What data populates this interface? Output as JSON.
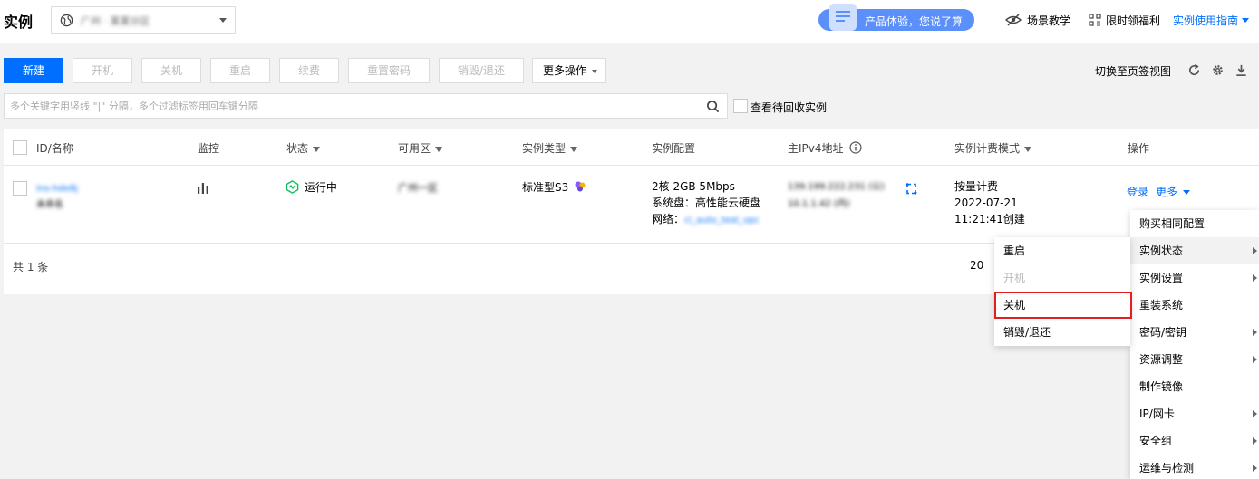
{
  "header": {
    "title": "实例",
    "region_value": "广州 · 某某分区",
    "experience_text": "产品体验，您说了算",
    "scene_teaching": "场景教学",
    "limited_benefit": "限时领福利",
    "guide_label": "实例使用指南"
  },
  "toolbar": {
    "new_label": "新建",
    "start_label": "开机",
    "shutdown_label": "关机",
    "restart_label": "重启",
    "renew_label": "续费",
    "reset_password_label": "重置密码",
    "destroy_label": "销毁/退还",
    "more_label": "更多操作",
    "switch_view_label": "切换至页签视图"
  },
  "search": {
    "placeholder": "多个关键字用竖线 \"|\" 分隔，多个过滤标签用回车键分隔",
    "recycle_label": "查看待回收实例"
  },
  "table": {
    "columns": [
      "ID/名称",
      "监控",
      "状态",
      "可用区",
      "实例类型",
      "实例配置",
      "主IPv4地址",
      "实例计费模式",
      "操作"
    ],
    "row": {
      "id": "ins-hde8j",
      "name": "未命名",
      "status": "运行中",
      "zone": "广州一区",
      "type": "标准型S3",
      "config_line1": "2核 2GB 5Mbps",
      "config_line2": "系统盘：高性能云硬盘",
      "config_network_label": "网络：",
      "config_network_value": "ci_auto_test_vpc",
      "ip_public": "139.199.222.231 (公)",
      "ip_private": "10.1.1.42 (内)",
      "billing_mode": "按量计费",
      "created_date": "2022-07-21",
      "created_time": "11:21:41创建",
      "action_login": "登录",
      "action_more": "更多"
    },
    "total": "共 1 条",
    "page_size": "20"
  },
  "more_menu": {
    "items": [
      {
        "label": "购买相同配置",
        "has_sub": false
      },
      {
        "label": "实例状态",
        "has_sub": true
      },
      {
        "label": "实例设置",
        "has_sub": true
      },
      {
        "label": "重装系统",
        "has_sub": false
      },
      {
        "label": "密码/密钥",
        "has_sub": true
      },
      {
        "label": "资源调整",
        "has_sub": true
      },
      {
        "label": "制作镜像",
        "has_sub": false
      },
      {
        "label": "IP/网卡",
        "has_sub": true
      },
      {
        "label": "安全组",
        "has_sub": true
      },
      {
        "label": "运维与检测",
        "has_sub": true
      }
    ]
  },
  "status_submenu": {
    "items": [
      {
        "label": "重启",
        "disabled": false
      },
      {
        "label": "开机",
        "disabled": true
      },
      {
        "label": "关机",
        "disabled": false
      },
      {
        "label": "销毁/退还",
        "disabled": false
      }
    ]
  },
  "colors": {
    "primary": "#006eff",
    "running": "#0abf5b",
    "highlight": "#e02020"
  }
}
